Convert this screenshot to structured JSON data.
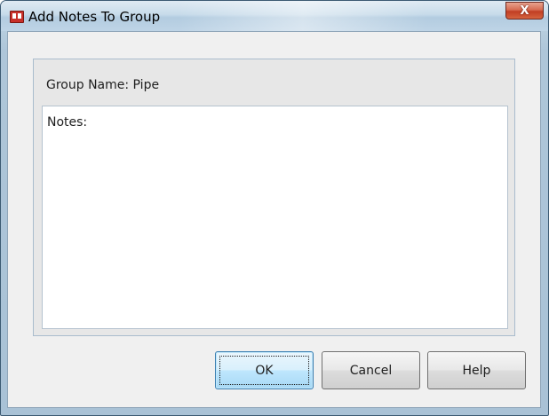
{
  "window": {
    "title": "Add Notes To Group",
    "close_label": "X"
  },
  "group": {
    "name_label": "Group Name: Pipe"
  },
  "notes": {
    "value": "Notes:"
  },
  "buttons": {
    "ok_label": "OK",
    "cancel_label": "Cancel",
    "help_label": "Help"
  },
  "colors": {
    "close_button": "#c13e23",
    "default_button_border": "#3c7fb1"
  },
  "icons": {
    "app": "book-icon",
    "close": "close-icon"
  }
}
